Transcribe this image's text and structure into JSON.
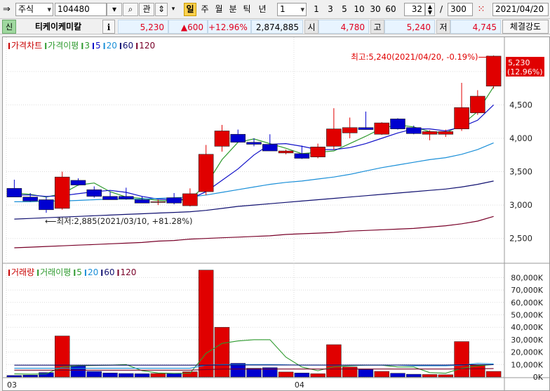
{
  "toolbar": {
    "market": "주식",
    "code": "104480",
    "gwan": "관",
    "period_buttons": [
      "일",
      "주",
      "월",
      "분",
      "틱",
      "년"
    ],
    "active_period": "일",
    "interval_value": "1",
    "interval_buttons": [
      "1",
      "3",
      "5",
      "10",
      "30",
      "60"
    ],
    "count": "32",
    "slash": "/",
    "total": "300",
    "date": "2021/04/20"
  },
  "quote": {
    "badge": "신",
    "name": "티케이케미칼",
    "info_icon": "i",
    "price": "5,230",
    "change": "▲600",
    "rate": "+12.96%",
    "volume": "2,874,885",
    "open_label": "시",
    "open": "4,780",
    "high_label": "고",
    "high": "5,240",
    "low_label": "저",
    "low": "4,745",
    "strength_button": "체결강도"
  },
  "price_legend": [
    {
      "text": "가격차트",
      "color": "#c80000"
    },
    {
      "text": "가격이평",
      "color": "#2e9a2e"
    },
    {
      "text": "3",
      "color": "#2e9a2e"
    },
    {
      "text": "5",
      "color": "#1010c8"
    },
    {
      "text": "20",
      "color": "#1a8fd8"
    },
    {
      "text": "60",
      "color": "#101070"
    },
    {
      "text": "120",
      "color": "#780028"
    }
  ],
  "volume_legend": [
    {
      "text": "거래량",
      "color": "#c80000"
    },
    {
      "text": "거래이평",
      "color": "#2e9a2e"
    },
    {
      "text": "5",
      "color": "#2e9a2e"
    },
    {
      "text": "20",
      "color": "#1a8fd8"
    },
    {
      "text": "60",
      "color": "#101070"
    },
    {
      "text": "120",
      "color": "#780028"
    }
  ],
  "annotations": {
    "high": "최고:5,240(2021/04/20, -0.19%)⟶",
    "low": "⟵최저:2,885(2021/03/10, +81.28%)",
    "last_price": "5,230",
    "last_rate": "(12.96%)"
  },
  "chart_data": [
    {
      "type": "candlestick",
      "title": "가격차트",
      "y_ticks": [
        2500,
        3000,
        3500,
        4000,
        4500,
        5000
      ],
      "y_tick_labels": [
        "2,500",
        "3,000",
        "3,500",
        "4,000",
        "4,500",
        "5,000"
      ],
      "ylim": [
        2150,
        5450
      ],
      "x_labels": [
        {
          "label": "03",
          "index": 0
        },
        {
          "label": "04",
          "index": 18
        }
      ],
      "colors": {
        "up": "#e00000",
        "down": "#0000d0"
      },
      "candles": [
        {
          "o": 3250,
          "h": 3380,
          "l": 3130,
          "c": 3120
        },
        {
          "o": 3120,
          "h": 3180,
          "l": 3050,
          "c": 3060
        },
        {
          "o": 3080,
          "h": 3120,
          "l": 2885,
          "c": 2930
        },
        {
          "o": 2950,
          "h": 3500,
          "l": 2930,
          "c": 3420
        },
        {
          "o": 3370,
          "h": 3400,
          "l": 3290,
          "c": 3300
        },
        {
          "o": 3230,
          "h": 3280,
          "l": 3110,
          "c": 3130
        },
        {
          "o": 3130,
          "h": 3200,
          "l": 3080,
          "c": 3080
        },
        {
          "o": 3130,
          "h": 3260,
          "l": 3080,
          "c": 3090
        },
        {
          "o": 3080,
          "h": 3130,
          "l": 3030,
          "c": 3030
        },
        {
          "o": 3040,
          "h": 3080,
          "l": 3000,
          "c": 3050
        },
        {
          "o": 3110,
          "h": 3180,
          "l": 3010,
          "c": 3030
        },
        {
          "o": 2990,
          "h": 3250,
          "l": 2980,
          "c": 3170
        },
        {
          "o": 3200,
          "h": 3900,
          "l": 3150,
          "c": 3760
        },
        {
          "o": 3880,
          "h": 4200,
          "l": 3800,
          "c": 4110
        },
        {
          "o": 4060,
          "h": 4130,
          "l": 3950,
          "c": 3940
        },
        {
          "o": 3940,
          "h": 4000,
          "l": 3880,
          "c": 3910
        },
        {
          "o": 3910,
          "h": 4060,
          "l": 3820,
          "c": 3810
        },
        {
          "o": 3780,
          "h": 3830,
          "l": 3760,
          "c": 3810
        },
        {
          "o": 3770,
          "h": 3890,
          "l": 3690,
          "c": 3700
        },
        {
          "o": 3720,
          "h": 3920,
          "l": 3700,
          "c": 3870
        },
        {
          "o": 3880,
          "h": 4450,
          "l": 3830,
          "c": 4140
        },
        {
          "o": 4080,
          "h": 4310,
          "l": 4000,
          "c": 4160
        },
        {
          "o": 4160,
          "h": 4400,
          "l": 4130,
          "c": 4130
        },
        {
          "o": 4060,
          "h": 4240,
          "l": 4050,
          "c": 4230
        },
        {
          "o": 4290,
          "h": 4300,
          "l": 4130,
          "c": 4140
        },
        {
          "o": 4160,
          "h": 4190,
          "l": 4060,
          "c": 4070
        },
        {
          "o": 4060,
          "h": 4120,
          "l": 3970,
          "c": 4100
        },
        {
          "o": 4060,
          "h": 4130,
          "l": 4020,
          "c": 4100
        },
        {
          "o": 4140,
          "h": 4830,
          "l": 4110,
          "c": 4460
        },
        {
          "o": 4380,
          "h": 4720,
          "l": 4350,
          "c": 4630
        },
        {
          "o": 4780,
          "h": 5240,
          "l": 4745,
          "c": 5230
        }
      ],
      "ma": [
        {
          "name": "3",
          "color": "#2e9a2e",
          "values": [
            3180,
            3160,
            3120,
            3170,
            3300,
            3330,
            3200,
            3120,
            3100,
            3070,
            3060,
            3090,
            3300,
            3680,
            3940,
            3990,
            3920,
            3850,
            3770,
            3790,
            3810,
            3920,
            4030,
            4150,
            4200,
            4170,
            4100,
            4080,
            4200,
            4400,
            4770
          ]
        },
        {
          "name": "5",
          "color": "#1010c8",
          "values": [
            3150,
            3150,
            3130,
            3140,
            3170,
            3200,
            3220,
            3190,
            3130,
            3090,
            3080,
            3090,
            3200,
            3370,
            3540,
            3750,
            3910,
            3920,
            3880,
            3830,
            3830,
            3860,
            3920,
            4000,
            4080,
            4140,
            4140,
            4110,
            4170,
            4270,
            4500
          ]
        },
        {
          "name": "20",
          "color": "#1a8fd8",
          "values": [
            3050,
            3050,
            3060,
            3060,
            3070,
            3080,
            3090,
            3090,
            3090,
            3100,
            3110,
            3120,
            3150,
            3190,
            3230,
            3270,
            3310,
            3340,
            3360,
            3390,
            3420,
            3460,
            3510,
            3560,
            3600,
            3640,
            3680,
            3710,
            3760,
            3830,
            3930
          ]
        },
        {
          "name": "60",
          "color": "#101070",
          "values": [
            2790,
            2800,
            2810,
            2820,
            2830,
            2840,
            2850,
            2860,
            2870,
            2880,
            2890,
            2900,
            2920,
            2950,
            2980,
            3000,
            3020,
            3040,
            3060,
            3080,
            3100,
            3120,
            3140,
            3160,
            3180,
            3200,
            3220,
            3240,
            3270,
            3310,
            3360
          ]
        },
        {
          "name": "120",
          "color": "#780028",
          "values": [
            2360,
            2370,
            2380,
            2390,
            2400,
            2410,
            2420,
            2430,
            2440,
            2460,
            2470,
            2490,
            2500,
            2510,
            2520,
            2530,
            2540,
            2560,
            2570,
            2580,
            2590,
            2610,
            2620,
            2630,
            2640,
            2650,
            2670,
            2690,
            2720,
            2760,
            2830
          ]
        }
      ]
    },
    {
      "type": "bar",
      "title": "거래량",
      "y_ticks": [
        0,
        10000,
        20000,
        30000,
        40000,
        50000,
        60000,
        70000,
        80000
      ],
      "y_tick_labels": [
        "0K",
        "10,000K",
        "20,000K",
        "30,000K",
        "40,000K",
        "50,000K",
        "60,000K",
        "70,000K",
        "80,000K"
      ],
      "ylim": [
        0,
        87000
      ],
      "values": [
        1200,
        1500,
        3500,
        33000,
        9000,
        4500,
        3200,
        2800,
        2600,
        2800,
        3000,
        4200,
        86000,
        40000,
        11000,
        7000,
        7500,
        4000,
        3200,
        2600,
        26000,
        8000,
        6000,
        4500,
        3000,
        2200,
        2000,
        1800,
        28500,
        9500,
        4500
      ],
      "ma": [
        {
          "name": "5",
          "color": "#2e9a2e",
          "values": [
            2500,
            2300,
            2500,
            8000,
            9000,
            9200,
            9500,
            10000,
            5000,
            3200,
            2900,
            3000,
            19000,
            27000,
            29000,
            30000,
            30000,
            16000,
            8000,
            5000,
            8200,
            9000,
            9500,
            9500,
            8000,
            8000,
            3500,
            3000,
            7000,
            9000,
            10000
          ]
        },
        {
          "name": "20",
          "color": "#1a8fd8",
          "values": [
            7000,
            7000,
            7000,
            7000,
            7000,
            7000,
            7000,
            7000,
            7000,
            7000,
            7000,
            7000,
            9500,
            10000,
            10000,
            10000,
            10000,
            9800,
            9500,
            9500,
            9500,
            9500,
            9500,
            9500,
            9500,
            9000,
            9000,
            9000,
            9500,
            11000,
            10500
          ]
        },
        {
          "name": "60",
          "color": "#101070",
          "values": [
            9500,
            9500,
            9500,
            9500,
            9500,
            9500,
            9500,
            9500,
            9500,
            9500,
            9500,
            9500,
            9500,
            9600,
            9600,
            9600,
            9600,
            9600,
            9600,
            9600,
            9600,
            9600,
            9600,
            9600,
            9600,
            9600,
            9600,
            9600,
            9800,
            9900,
            9900
          ]
        },
        {
          "name": "120",
          "color": "#780028",
          "values": [
            5500,
            5500,
            5500,
            5500,
            5500,
            5500,
            5500,
            5500,
            5500,
            5500,
            5500,
            5500,
            6000,
            6300,
            6400,
            6400,
            6400,
            6400,
            6400,
            6400,
            6400,
            6400,
            6400,
            6400,
            6400,
            6400,
            6400,
            6400,
            6500,
            6600,
            6700
          ]
        }
      ]
    }
  ]
}
